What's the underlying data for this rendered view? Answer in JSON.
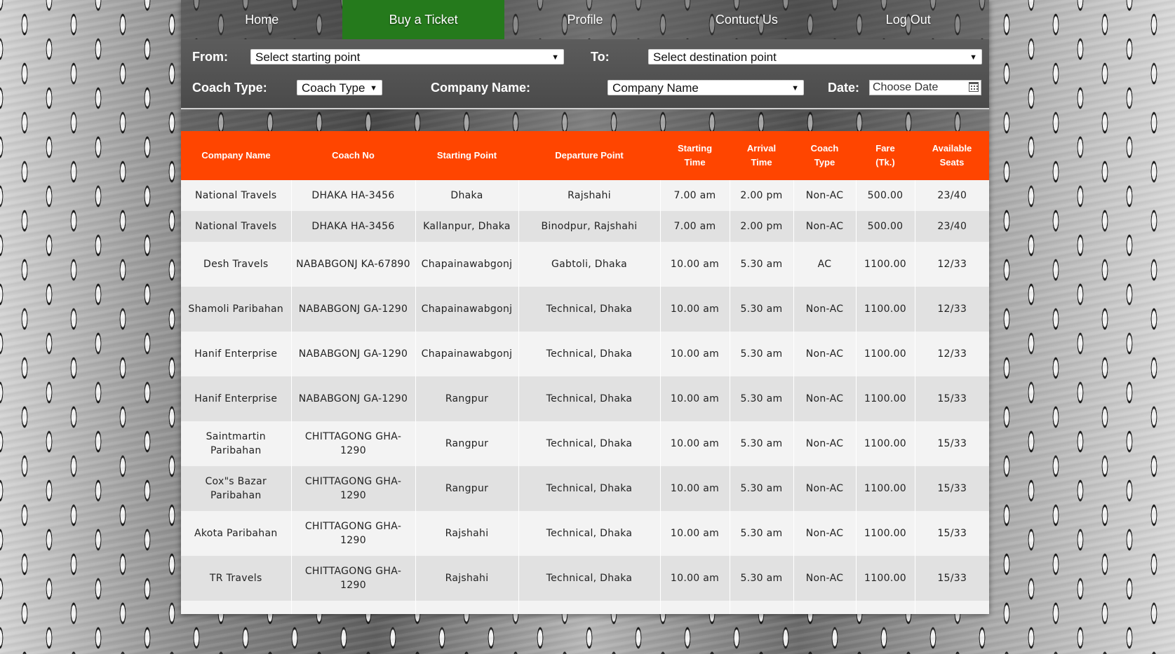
{
  "nav": {
    "items": [
      {
        "label": "Home",
        "active": false
      },
      {
        "label": "Buy a Ticket",
        "active": true
      },
      {
        "label": "Profile",
        "active": false
      },
      {
        "label": "Contuct Us",
        "active": false
      },
      {
        "label": "Log Out",
        "active": false
      }
    ]
  },
  "filters": {
    "from_label": "From:",
    "from_value": "Select starting point",
    "to_label": "To:",
    "to_value": "Select destination point",
    "coach_type_label": "Coach Type:",
    "coach_type_value": "Coach Type",
    "company_label": "Company Name:",
    "company_value": "Company Name",
    "date_label": "Date:",
    "date_placeholder": "Choose Date",
    "dropdown_arrow": "▼"
  },
  "table": {
    "headers": [
      {
        "line1": "Company Name",
        "line2": ""
      },
      {
        "line1": "Coach No",
        "line2": ""
      },
      {
        "line1": "Starting Point",
        "line2": ""
      },
      {
        "line1": "Departure Point",
        "line2": ""
      },
      {
        "line1": "Starting",
        "line2": "Time"
      },
      {
        "line1": "Arrival",
        "line2": "Time"
      },
      {
        "line1": "Coach",
        "line2": "Type"
      },
      {
        "line1": "Fare",
        "line2": "(Tk.)"
      },
      {
        "line1": "Available",
        "line2": "Seats"
      }
    ],
    "rows": [
      {
        "company": "National Travels",
        "coach_no": "DHAKA HA-3456",
        "start": "Dhaka",
        "departure": "Rajshahi",
        "start_time": "7.00 am",
        "arrival_time": "2.00 pm",
        "type": "Non-AC",
        "fare": "500.00",
        "seats": "23/40"
      },
      {
        "company": "National Travels",
        "coach_no": "DHAKA HA-3456",
        "start": "Kallanpur, Dhaka",
        "departure": "Binodpur, Rajshahi",
        "start_time": "7.00 am",
        "arrival_time": "2.00 pm",
        "type": "Non-AC",
        "fare": "500.00",
        "seats": "23/40"
      },
      {
        "company": "Desh Travels",
        "coach_no": "NABABGONJ KA-67890",
        "start": "Chapainawabgonj",
        "departure": "Gabtoli, Dhaka",
        "start_time": "10.00 am",
        "arrival_time": "5.30 am",
        "type": "AC",
        "fare": "1100.00",
        "seats": "12/33"
      },
      {
        "company": "Shamoli Paribahan",
        "coach_no": "NABABGONJ GA-1290",
        "start": "Chapainawabgonj",
        "departure": "Technical, Dhaka",
        "start_time": "10.00 am",
        "arrival_time": "5.30 am",
        "type": "Non-AC",
        "fare": "1100.00",
        "seats": "12/33"
      },
      {
        "company": "Hanif Enterprise",
        "coach_no": "NABABGONJ GA-1290",
        "start": "Chapainawabgonj",
        "departure": "Technical, Dhaka",
        "start_time": "10.00 am",
        "arrival_time": "5.30 am",
        "type": "Non-AC",
        "fare": "1100.00",
        "seats": "12/33"
      },
      {
        "company": "Hanif Enterprise",
        "coach_no": "NABABGONJ GA-1290",
        "start": "Rangpur",
        "departure": "Technical, Dhaka",
        "start_time": "10.00 am",
        "arrival_time": "5.30 am",
        "type": "Non-AC",
        "fare": "1100.00",
        "seats": "15/33"
      },
      {
        "company": "Saintmartin Paribahan",
        "coach_no": "CHITTAGONG GHA-1290",
        "start": "Rangpur",
        "departure": "Technical, Dhaka",
        "start_time": "10.00 am",
        "arrival_time": "5.30 am",
        "type": "Non-AC",
        "fare": "1100.00",
        "seats": "15/33"
      },
      {
        "company": "Cox\"s Bazar Paribahan",
        "coach_no": "CHITTAGONG GHA-1290",
        "start": "Rangpur",
        "departure": "Technical, Dhaka",
        "start_time": "10.00 am",
        "arrival_time": "5.30 am",
        "type": "Non-AC",
        "fare": "1100.00",
        "seats": "15/33"
      },
      {
        "company": "Akota Paribahan",
        "coach_no": "CHITTAGONG GHA-1290",
        "start": "Rajshahi",
        "departure": "Technical, Dhaka",
        "start_time": "10.00 am",
        "arrival_time": "5.30 am",
        "type": "Non-AC",
        "fare": "1100.00",
        "seats": "15/33"
      },
      {
        "company": "TR Travels",
        "coach_no": "CHITTAGONG GHA-1290",
        "start": "Rajshahi",
        "departure": "Technical, Dhaka",
        "start_time": "10.00 am",
        "arrival_time": "5.30 am",
        "type": "Non-AC",
        "fare": "1100.00",
        "seats": "15/33"
      },
      {
        "company": "",
        "coach_no": "",
        "start": "",
        "departure": "",
        "start_time": "",
        "arrival_time": "",
        "type": "",
        "fare": "",
        "seats": ""
      }
    ]
  }
}
